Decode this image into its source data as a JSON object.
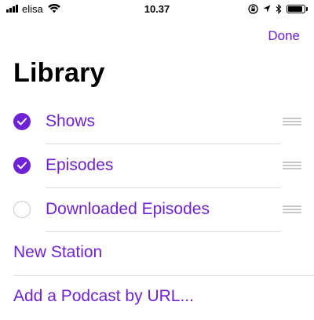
{
  "status_bar": {
    "carrier": "elisa",
    "time": "10.37",
    "battery_level": 0.9,
    "icons": [
      "signal-icon",
      "wifi-icon",
      "orientation-lock-icon",
      "location-icon",
      "bluetooth-icon",
      "battery-icon"
    ]
  },
  "nav": {
    "done_label": "Done"
  },
  "page": {
    "title": "Library"
  },
  "library_items": [
    {
      "label": "Shows",
      "checked": true
    },
    {
      "label": "Episodes",
      "checked": true
    },
    {
      "label": "Downloaded Episodes",
      "checked": false
    }
  ],
  "actions": [
    {
      "label": "New Station"
    },
    {
      "label": "Add a Podcast by URL..."
    }
  ],
  "colors": {
    "accent": "#6e22d6",
    "divider": "#dcdcdf",
    "unchecked_border": "#c8c7cc",
    "reorder_handle": "#c7c7cc"
  }
}
